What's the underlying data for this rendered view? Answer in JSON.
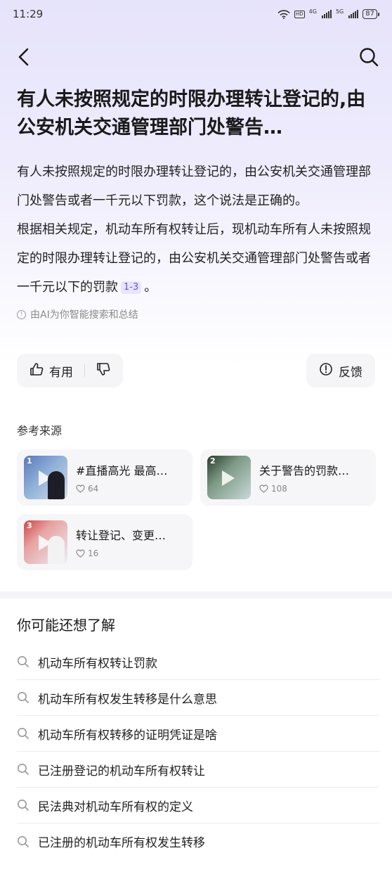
{
  "status": {
    "time": "11:29",
    "battery": "87",
    "net1": "4G",
    "net2": "5G"
  },
  "nav": {
    "back": "back-icon",
    "search": "search-icon"
  },
  "title": "有人未按照规定的时限办理转让登记的,由公安机关交通管理部门处警告…",
  "answer": {
    "para1": "有人未按照规定的时限办理转让登记的，由公安机关交通管理部门处警告或者一千元以下罚款，这个说法是正确的。",
    "para2": "根据相关规定，机动车所有权转让后，现机动车所有人未按照规定的时限办理转让登记的，由公安机关交通管理部门处警告或者一千元以下的罚款",
    "citation": "1-3",
    "para2_end": "。"
  },
  "ai_note": "由AI为你智能搜索和总结",
  "feedback": {
    "useful_label": "有用",
    "feedback_label": "反馈"
  },
  "sources": {
    "label": "参考来源",
    "items": [
      {
        "index": "1",
        "title": "#直播高光 最高…",
        "likes": "64"
      },
      {
        "index": "2",
        "title": "关于警告的罚款…",
        "likes": "108"
      },
      {
        "index": "3",
        "title": "转让登记、变更…",
        "likes": "16"
      }
    ]
  },
  "more": {
    "title": "你可能还想了解",
    "items": [
      "机动车所有权转让罚款",
      "机动车所有权发生转移是什么意思",
      "机动车所有权转移的证明凭证是啥",
      "已注册登记的机动车所有权转让",
      "民法典对机动车所有权的定义",
      "已注册的机动车所有权发生转移"
    ]
  },
  "colors": {
    "accent": "#6a4ff0",
    "header_bg": "#e6e3fb"
  }
}
